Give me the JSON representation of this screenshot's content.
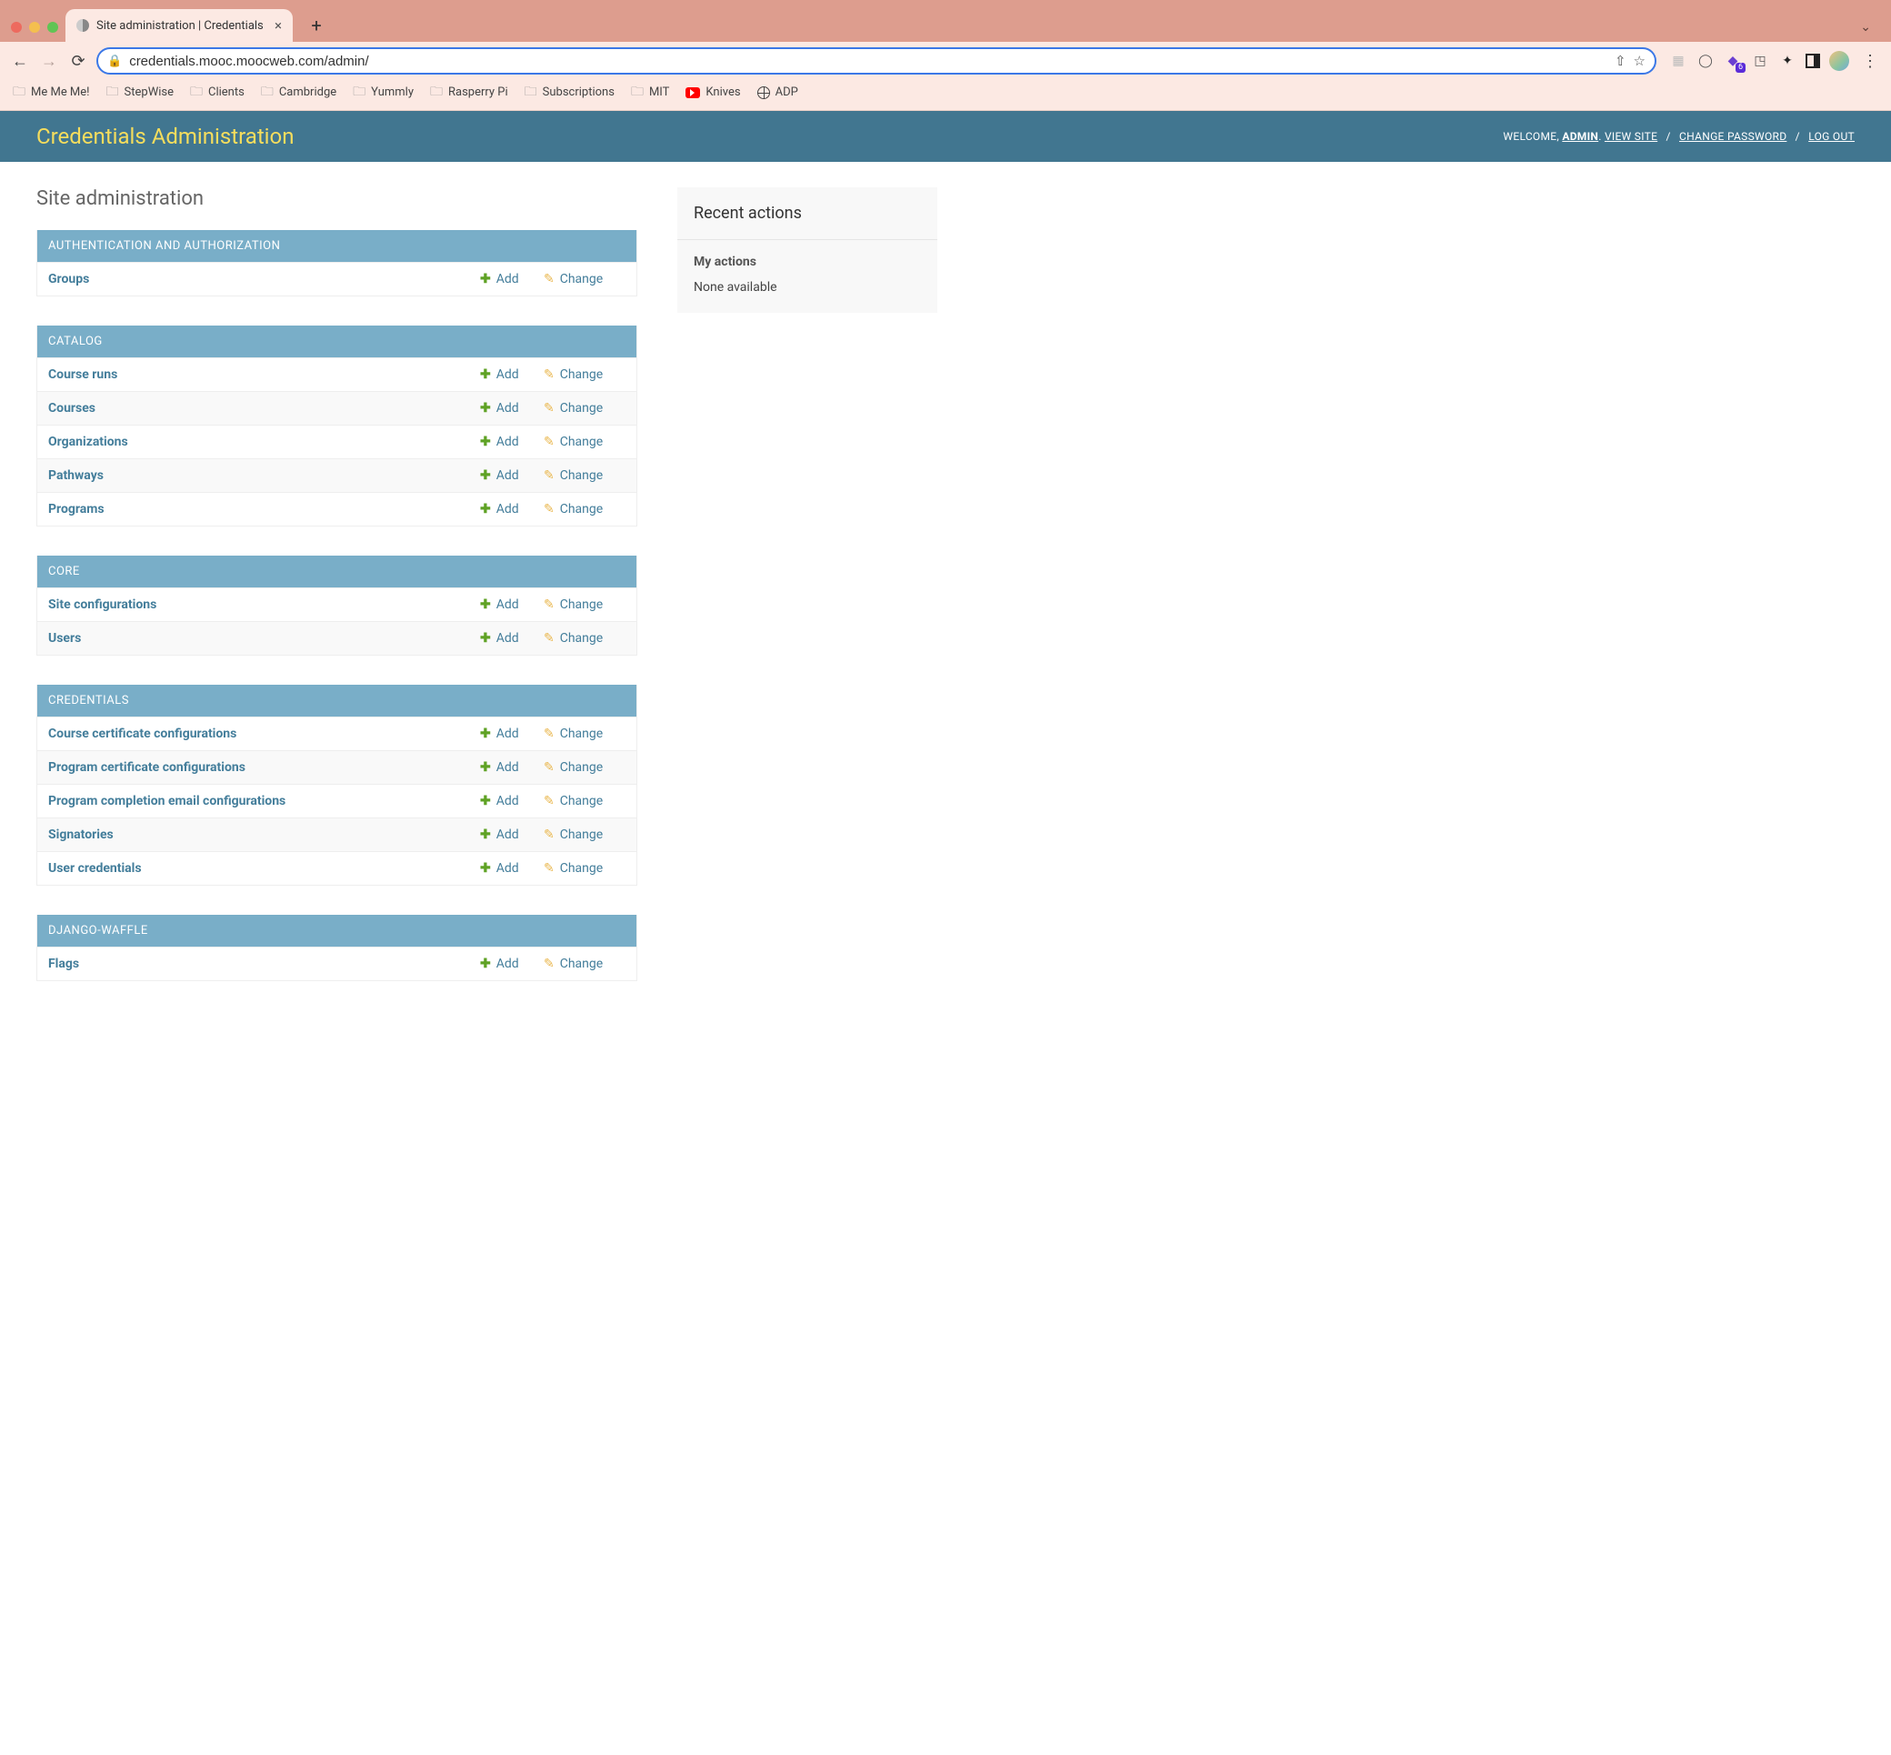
{
  "browser": {
    "tab_title": "Site administration | Credentials",
    "url": "credentials.mooc.moocweb.com/admin/",
    "bookmarks": [
      "Me Me Me!",
      "StepWise",
      "Clients",
      "Cambridge",
      "Yummly",
      "Rasperry Pi",
      "Subscriptions",
      "MIT",
      "Knives",
      "ADP"
    ],
    "ext_badge": "6"
  },
  "header": {
    "brand": "Credentials Administration",
    "welcome": "WELCOME,",
    "user": "ADMIN",
    "view_site": "VIEW SITE",
    "change_password": "CHANGE PASSWORD",
    "log_out": "LOG OUT"
  },
  "page_title": "Site administration",
  "actions": {
    "add": "Add",
    "change": "Change"
  },
  "modules": [
    {
      "title": "Authentication and Authorization",
      "rows": [
        {
          "name": "Groups"
        }
      ]
    },
    {
      "title": "Catalog",
      "rows": [
        {
          "name": "Course runs"
        },
        {
          "name": "Courses"
        },
        {
          "name": "Organizations"
        },
        {
          "name": "Pathways"
        },
        {
          "name": "Programs"
        }
      ]
    },
    {
      "title": "Core",
      "rows": [
        {
          "name": "Site configurations"
        },
        {
          "name": "Users"
        }
      ]
    },
    {
      "title": "Credentials",
      "rows": [
        {
          "name": "Course certificate configurations"
        },
        {
          "name": "Program certificate configurations"
        },
        {
          "name": "Program completion email configurations"
        },
        {
          "name": "Signatories"
        },
        {
          "name": "User credentials"
        }
      ]
    },
    {
      "title": "Django-Waffle",
      "rows": [
        {
          "name": "Flags"
        }
      ]
    }
  ],
  "sidebar": {
    "recent_title": "Recent actions",
    "my_actions": "My actions",
    "none": "None available"
  }
}
